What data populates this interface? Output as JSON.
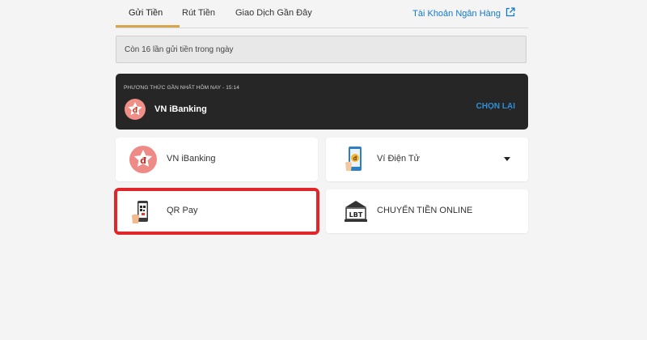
{
  "tabs": [
    {
      "label": "Gửi Tiền"
    },
    {
      "label": "Rút Tiền"
    },
    {
      "label": "Giao Dịch Gần Đây"
    }
  ],
  "bank_account_link": "Tài Khoản Ngân Hàng",
  "notice": "Còn 16 lần gửi tiền trong ngày",
  "recent": {
    "label": "PHƯƠNG THỨC GẦN NHẤT HÔM NAY - 15:14",
    "method": "VN iBanking",
    "reselect": "CHỌN LẠI"
  },
  "methods": [
    {
      "label": "VN iBanking"
    },
    {
      "label": "Ví Điện Tử"
    },
    {
      "label": "QR Pay"
    },
    {
      "label": "CHUYỂN TIỀN ONLINE"
    }
  ],
  "icons": {
    "recent": "dong-coin-icon",
    "vn_ibanking": "dong-coin-icon",
    "wallet": "phone-wallet-icon",
    "qr": "phone-qr-icon",
    "transfer": "bank-building-icon",
    "external": "external-link-icon"
  },
  "colors": {
    "accent": "#d7a64b",
    "link": "#1479c7",
    "selected_border": "#e0262b",
    "recent_bg": "#262626"
  }
}
